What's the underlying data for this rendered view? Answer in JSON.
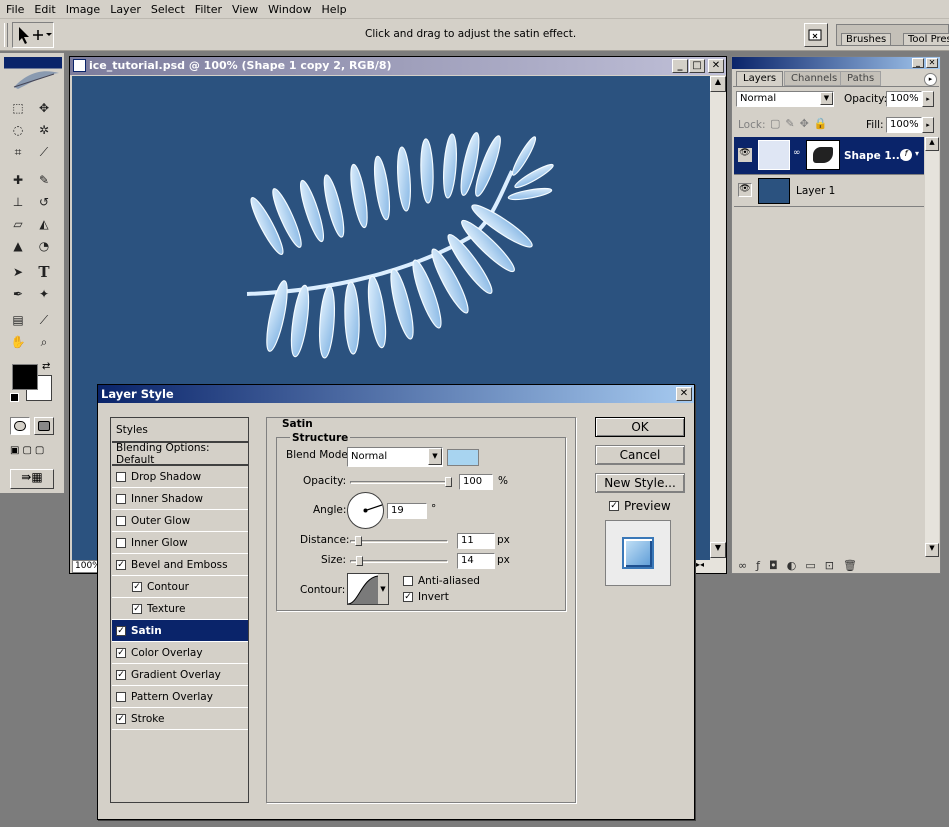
{
  "menu": [
    "File",
    "Edit",
    "Image",
    "Layer",
    "Select",
    "Filter",
    "View",
    "Window",
    "Help"
  ],
  "options_bar": {
    "hint": "Click and drag to adjust the satin effect.",
    "palette_tabs": [
      "Brushes",
      "Tool Pres"
    ]
  },
  "document": {
    "title": "ice_tutorial.psd @ 100% (Shape 1 copy 2, RGB/8)",
    "zoom": "100%"
  },
  "layers_panel": {
    "tabs": [
      "Layers",
      "Channels",
      "Paths"
    ],
    "blend_mode": "Normal",
    "opacity_label": "Opacity:",
    "opacity": "100%",
    "lock_label": "Lock:",
    "fill_label": "Fill:",
    "fill": "100%",
    "layers": [
      {
        "name": "Shape 1...",
        "selected": true
      },
      {
        "name": "Layer 1",
        "selected": false
      }
    ]
  },
  "dialog": {
    "title": "Layer Style",
    "styles_header": "Styles",
    "blending": "Blending Options: Default",
    "items": [
      {
        "label": "Drop Shadow",
        "checked": false,
        "sub": false
      },
      {
        "label": "Inner Shadow",
        "checked": false,
        "sub": false
      },
      {
        "label": "Outer Glow",
        "checked": false,
        "sub": false
      },
      {
        "label": "Inner Glow",
        "checked": false,
        "sub": false
      },
      {
        "label": "Bevel and Emboss",
        "checked": true,
        "sub": false
      },
      {
        "label": "Contour",
        "checked": true,
        "sub": true
      },
      {
        "label": "Texture",
        "checked": true,
        "sub": true
      },
      {
        "label": "Satin",
        "checked": true,
        "sub": false,
        "selected": true
      },
      {
        "label": "Color Overlay",
        "checked": true,
        "sub": false
      },
      {
        "label": "Gradient Overlay",
        "checked": true,
        "sub": false
      },
      {
        "label": "Pattern Overlay",
        "checked": false,
        "sub": false
      },
      {
        "label": "Stroke",
        "checked": true,
        "sub": false
      }
    ],
    "section": "Satin",
    "group": "Structure",
    "blend_mode_label": "Blend Mode:",
    "blend_mode": "Normal",
    "satin_color": "#a8d4f0",
    "opacity_label": "Opacity:",
    "opacity": "100",
    "opacity_unit": "%",
    "angle_label": "Angle:",
    "angle": "19",
    "angle_unit": "°",
    "distance_label": "Distance:",
    "distance": "11",
    "distance_unit": "px",
    "size_label": "Size:",
    "size": "14",
    "size_unit": "px",
    "contour_label": "Contour:",
    "anti_aliased_label": "Anti-aliased",
    "anti_aliased": false,
    "invert_label": "Invert",
    "invert": true,
    "ok": "OK",
    "cancel": "Cancel",
    "new_style": "New Style...",
    "preview_label": "Preview",
    "preview": true
  }
}
